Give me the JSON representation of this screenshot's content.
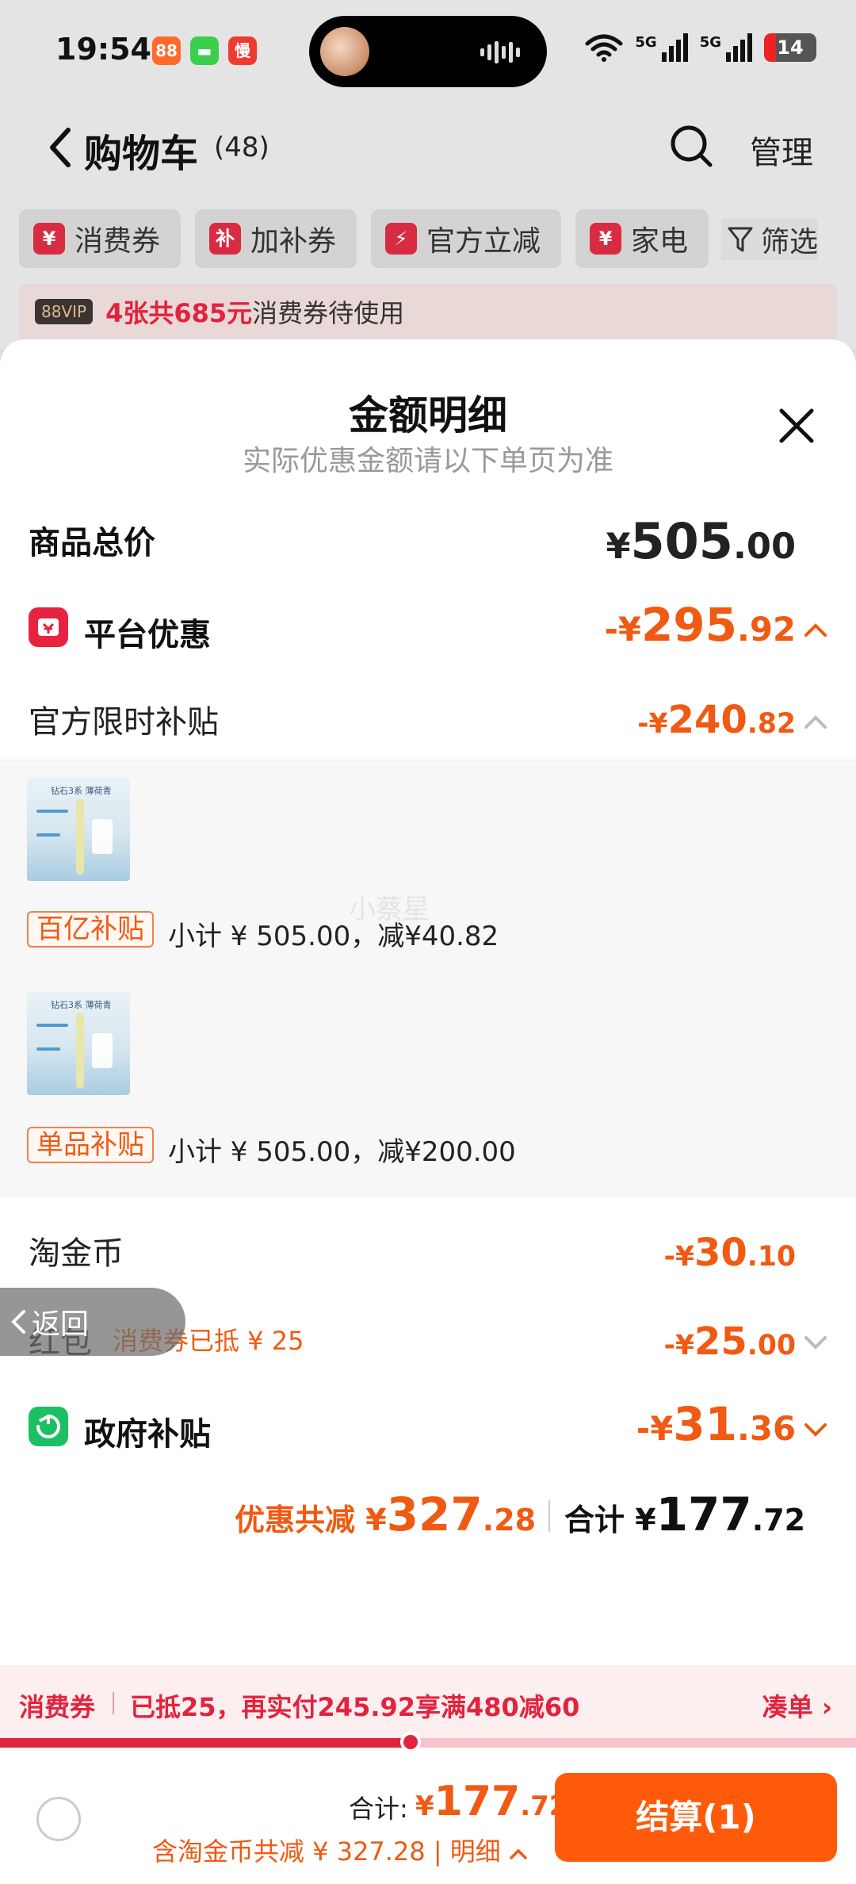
{
  "status_bar": {
    "time": "19:54",
    "apps": [
      {
        "icon": "taobao-app-icon",
        "glyph": "88",
        "color": "#ff6a2c"
      },
      {
        "icon": "messages-app-icon",
        "glyph": "▬",
        "color": "#3ccf4e"
      },
      {
        "icon": "man-app-icon",
        "glyph": "慢",
        "color": "#ee3b2f"
      }
    ],
    "network": [
      "5G",
      "5G"
    ],
    "battery": "14"
  },
  "nav": {
    "title": "购物车",
    "count": "(48)",
    "manage": "管理"
  },
  "chips": [
    {
      "badge": "¥",
      "label": "消费券"
    },
    {
      "badge": "补",
      "label": "加补券"
    },
    {
      "badge": "⚡",
      "label": "官方立减"
    },
    {
      "badge": "¥",
      "label": "家电"
    }
  ],
  "filter_label": "筛选",
  "notice": {
    "vip": "88VIP",
    "highlight": "4张共685元",
    "text": "消费券待使用"
  },
  "sheet": {
    "title": "金额明细",
    "subtitle": "实际优惠金额请以下单页为准",
    "goods_total": {
      "label": "商品总价",
      "prefix": "¥",
      "main": "505",
      "decimals": ".00"
    },
    "platform": {
      "label": "平台优惠",
      "prefix": "-¥",
      "main": "295",
      "decimals": ".92"
    },
    "official": {
      "label": "官方限时补贴",
      "prefix": "-¥",
      "main": "240",
      "decimals": ".82"
    },
    "items": [
      {
        "thumb_title": "钻石3系 薄荷青",
        "tag": "百亿补贴",
        "detail": "小计 ¥ 505.00，减¥40.82"
      },
      {
        "thumb_title": "钻石3系 薄荷青",
        "tag": "单品补贴",
        "detail": "小计 ¥ 505.00，减¥200.00"
      }
    ],
    "watermark": "小蔡星",
    "coins": {
      "label": "淘金币",
      "prefix": "-¥",
      "main": "30",
      "decimals": ".10"
    },
    "redpack": {
      "label": "红包",
      "note": "消费券已抵 ¥ 25",
      "prefix": "-¥",
      "main": "25",
      "decimals": ".00"
    },
    "gov": {
      "label": "政府补贴",
      "prefix": "-¥",
      "main": "31",
      "decimals": ".36"
    },
    "totals": {
      "discount_label": "优惠共减",
      "discount_prefix": "¥",
      "discount_main": "327",
      "discount_decimals": ".28",
      "sum_label": "合计",
      "sum_prefix": "¥",
      "sum_main": "177",
      "sum_decimals": ".72"
    },
    "back_label": "返回"
  },
  "coupon_bar": {
    "label": "消费券",
    "text": "已抵25，再实付245.92享满480减60",
    "link": "凑单",
    "progress": 0.48
  },
  "checkout": {
    "label": "合计:",
    "prefix": "¥",
    "main": "177",
    "decimals": ".72",
    "detail": "含淘金币共减 ¥ 327.28 | 明细",
    "button": "结算(1)"
  },
  "colors": {
    "accent_orange": "#f05a12",
    "button_orange": "#ff5a0a",
    "coupon_red": "#e2233d",
    "gov_green": "#1dbf63"
  }
}
